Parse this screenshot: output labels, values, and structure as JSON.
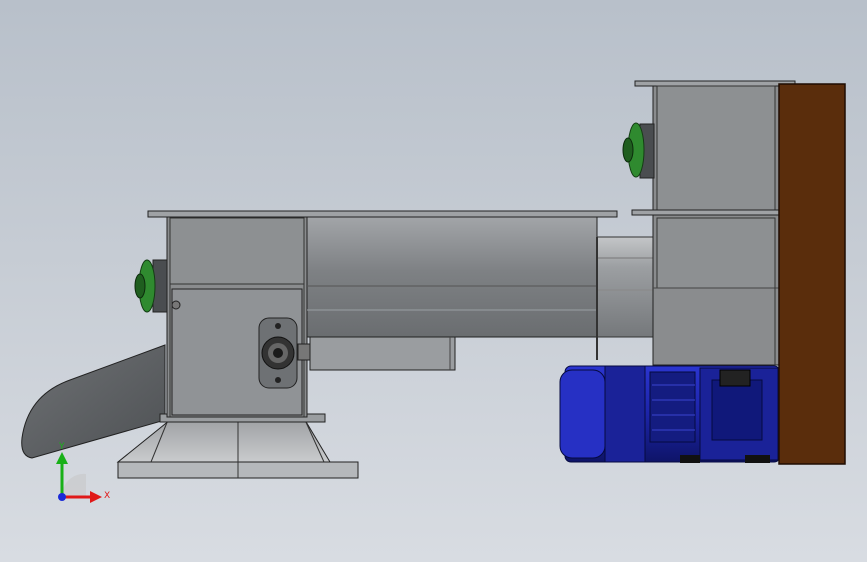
{
  "viewport": {
    "background_top": "#b8c0ca",
    "background_bottom": "#d8dce2"
  },
  "model": {
    "steel_color": "#8a8c8e",
    "steel_dark_color": "#6e7174",
    "motor_color": "#1c24a8",
    "wall_color": "#5a2d0c",
    "bearing_color": "#2f8a2f"
  },
  "triad": {
    "x_label": "X",
    "y_label": "Y",
    "x_color": "#e01818",
    "y_color": "#18b018",
    "z_color": "#1a2ad8"
  }
}
